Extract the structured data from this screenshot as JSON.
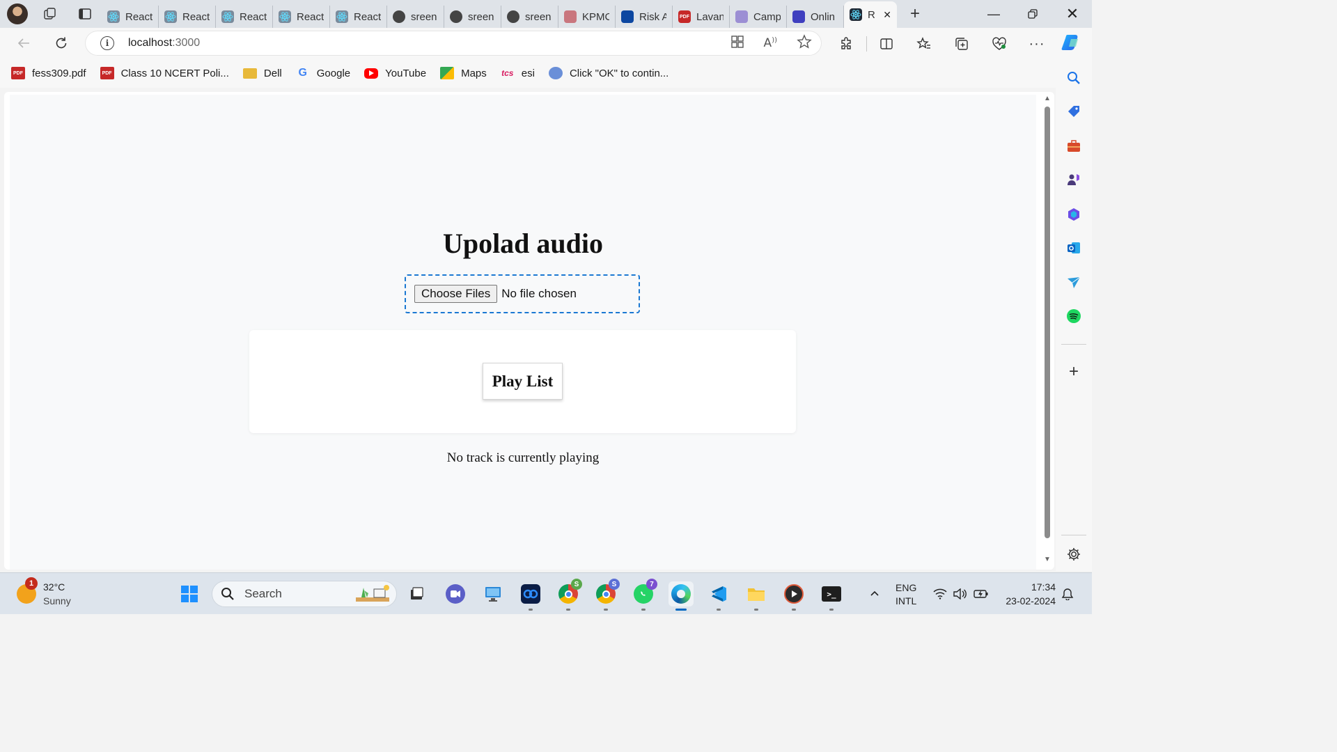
{
  "browser": {
    "tabs": [
      {
        "label": "React",
        "icon": "react-icon",
        "color": "#7a8b9c"
      },
      {
        "label": "React",
        "icon": "react-icon",
        "color": "#7a8b9c"
      },
      {
        "label": "React",
        "icon": "react-icon",
        "color": "#7a8b9c"
      },
      {
        "label": "React",
        "icon": "react-icon",
        "color": "#7a8b9c"
      },
      {
        "label": "React",
        "icon": "react-icon",
        "color": "#7a8b9c"
      },
      {
        "label": "sreen",
        "icon": "github-icon",
        "color": "#444444"
      },
      {
        "label": "sreen",
        "icon": "github-icon",
        "color": "#444444"
      },
      {
        "label": "sreen",
        "icon": "github-icon",
        "color": "#444444"
      },
      {
        "label": "KPMC",
        "icon": "kpmg-icon",
        "color": "#c9767e"
      },
      {
        "label": "Risk A",
        "icon": "doc-icon",
        "color": "#0d47a1"
      },
      {
        "label": "Lavan",
        "icon": "pdf-icon",
        "color": "#c62828"
      },
      {
        "label": "Camp",
        "icon": "site-icon",
        "color": "#9c8fd4"
      },
      {
        "label": "Onlin",
        "icon": "site-icon",
        "color": "#3f3fbf"
      },
      {
        "label": "R",
        "icon": "react-icon",
        "color": "#1f2a36",
        "active": true
      }
    ],
    "address": {
      "host": "localhost",
      "port": ":3000"
    },
    "bookmarks": [
      {
        "label": "fess309.pdf",
        "icon": "pdf-icon",
        "color": "#c62828"
      },
      {
        "label": "Class 10 NCERT Poli...",
        "icon": "pdf-icon",
        "color": "#c62828"
      },
      {
        "label": "Dell",
        "icon": "folder-icon",
        "color": "#e8b93a"
      },
      {
        "label": "Google",
        "icon": "google-icon",
        "color": "#4285f4"
      },
      {
        "label": "YouTube",
        "icon": "youtube-icon",
        "color": "#ff0000"
      },
      {
        "label": "Maps",
        "icon": "maps-icon",
        "color": "#34a853"
      },
      {
        "label": "esi",
        "icon": "tcs-icon",
        "color": "#d81b60"
      },
      {
        "label": "Click \"OK\" to contin...",
        "icon": "site-icon",
        "color": "#6a8fd8"
      }
    ]
  },
  "page": {
    "title": "Upolad audio",
    "file_input": {
      "button_label": "Choose Files",
      "status": "No file chosen"
    },
    "playlist_button": "Play List",
    "now_playing": "No track is currently playing"
  },
  "taskbar": {
    "weather": {
      "temp": "32°C",
      "condition": "Sunny",
      "badge": "1"
    },
    "search_placeholder": "Search",
    "language": {
      "line1": "ENG",
      "line2": "INTL"
    },
    "clock": {
      "time": "17:34",
      "date": "23-02-2024"
    },
    "badges": {
      "chrome_profile_1": "S",
      "chrome_profile_2": "S",
      "whatsapp": "7"
    }
  },
  "colors": {
    "dropzone_border": "#1a78d2",
    "page_bg": "#f8f9fa",
    "accent": "#0067c0"
  }
}
